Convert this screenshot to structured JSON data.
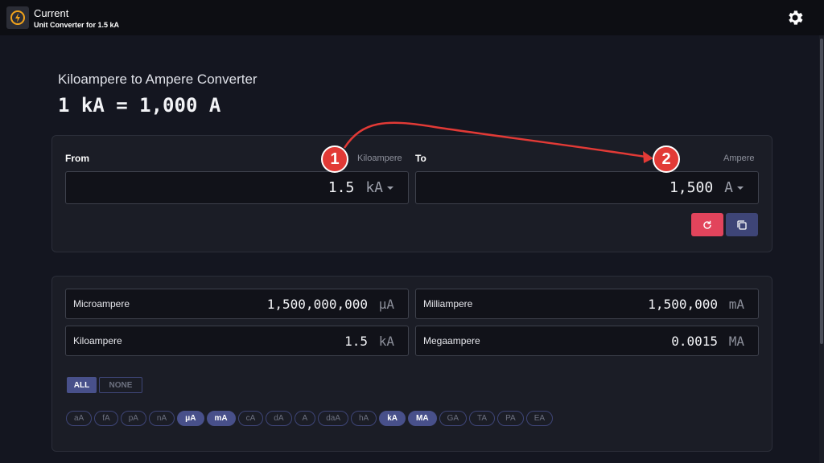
{
  "app": {
    "title": "Current",
    "subtitle": "Unit Converter for 1.5 kA"
  },
  "page": {
    "heading": "Kiloampere to Ampere Converter",
    "equation": "1 kA = 1,000 A"
  },
  "converter": {
    "from_label": "From",
    "from_unit_name": "Kiloampere",
    "from_value": "1.5",
    "from_unit": "kA",
    "to_label": "To",
    "to_unit_name": "Ampere",
    "to_value": "1,500",
    "to_unit": "A"
  },
  "results": [
    {
      "name": "Microampere",
      "value": "1,500,000,000",
      "unit": "μA"
    },
    {
      "name": "Milliampere",
      "value": "1,500,000",
      "unit": "mA"
    },
    {
      "name": "Kiloampere",
      "value": "1.5",
      "unit": "kA"
    },
    {
      "name": "Megaampere",
      "value": "0.0015",
      "unit": "MA"
    }
  ],
  "filters": {
    "all_label": "ALL",
    "none_label": "NONE"
  },
  "unit_chips": [
    {
      "label": "aA",
      "selected": false
    },
    {
      "label": "fA",
      "selected": false
    },
    {
      "label": "pA",
      "selected": false
    },
    {
      "label": "nA",
      "selected": false
    },
    {
      "label": "μA",
      "selected": true
    },
    {
      "label": "mA",
      "selected": true
    },
    {
      "label": "cA",
      "selected": false
    },
    {
      "label": "dA",
      "selected": false
    },
    {
      "label": "A",
      "selected": false
    },
    {
      "label": "daA",
      "selected": false
    },
    {
      "label": "hA",
      "selected": false
    },
    {
      "label": "kA",
      "selected": true
    },
    {
      "label": "MA",
      "selected": true
    },
    {
      "label": "GA",
      "selected": false
    },
    {
      "label": "TA",
      "selected": false
    },
    {
      "label": "PA",
      "selected": false
    },
    {
      "label": "EA",
      "selected": false
    }
  ],
  "annotations": {
    "badge_1": "1",
    "badge_2": "2"
  },
  "colors": {
    "accent": "#48508a",
    "reset_button": "#e2445c",
    "copy_button": "#3e4577",
    "annotation": "#e23a36"
  },
  "icons": {
    "app": "clock-bolt-icon",
    "settings": "gear-icon",
    "reset": "refresh-icon",
    "copy": "copy-icon"
  }
}
